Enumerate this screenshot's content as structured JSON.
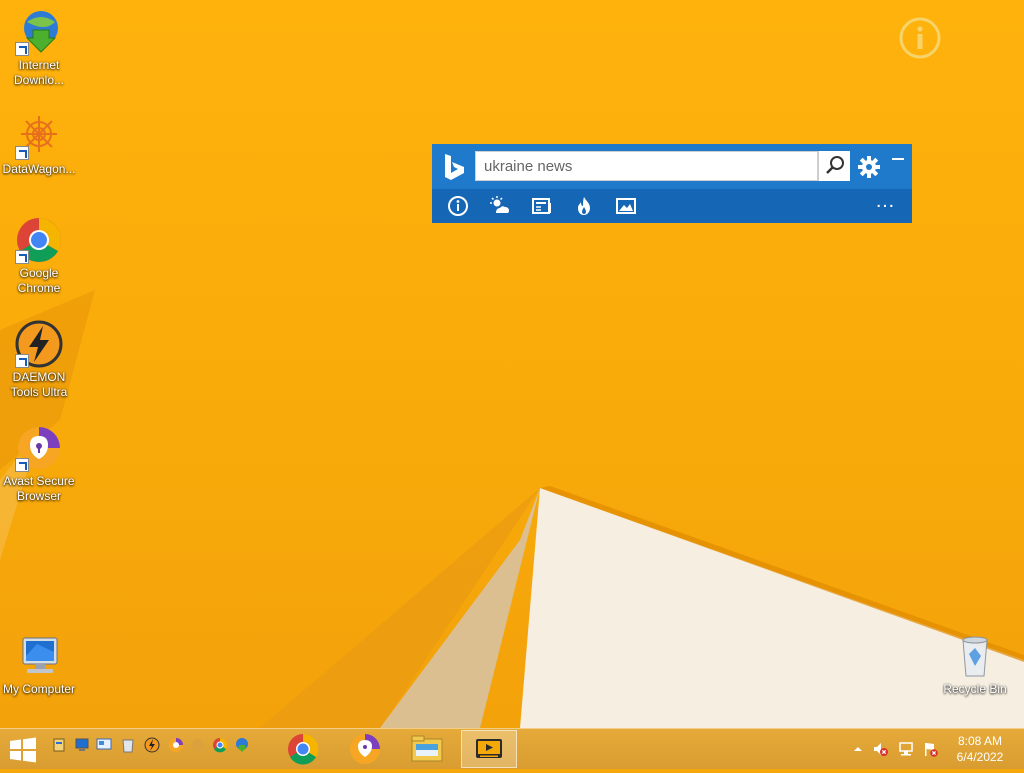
{
  "desktop": {
    "icons": [
      {
        "label_line1": "Internet",
        "label_line2": "Downlo...",
        "icon": "internet-download-manager-icon"
      },
      {
        "label_line1": "DataWagon...",
        "label_line2": "",
        "icon": "datawagon-icon"
      },
      {
        "label_line1": "Google",
        "label_line2": "Chrome",
        "icon": "chrome-icon"
      },
      {
        "label_line1": "DAEMON",
        "label_line2": "Tools Ultra",
        "icon": "daemon-tools-icon"
      },
      {
        "label_line1": "Avast Secure",
        "label_line2": "Browser",
        "icon": "avast-secure-browser-icon"
      },
      {
        "label_line1": "My Computer",
        "label_line2": "",
        "icon": "my-computer-icon"
      },
      {
        "label_line1": "Recycle Bin",
        "label_line2": "",
        "icon": "recycle-bin-icon"
      }
    ]
  },
  "bing_bar": {
    "search_value": "ukraine news",
    "tools": [
      "info-icon",
      "weather-icon",
      "news-icon",
      "trending-icon",
      "images-icon"
    ],
    "more": "…"
  },
  "taskbar": {
    "pinned": [
      "chrome-icon",
      "avast-secure-browser-icon",
      "file-explorer-icon",
      "media-player-icon"
    ],
    "clock_time": "8:08 AM",
    "clock_date": "6/4/2022"
  },
  "colors": {
    "desktop_bg": "#FFB20C",
    "bing_top": "#1F7ACB",
    "bing_bottom": "#1566B5"
  }
}
